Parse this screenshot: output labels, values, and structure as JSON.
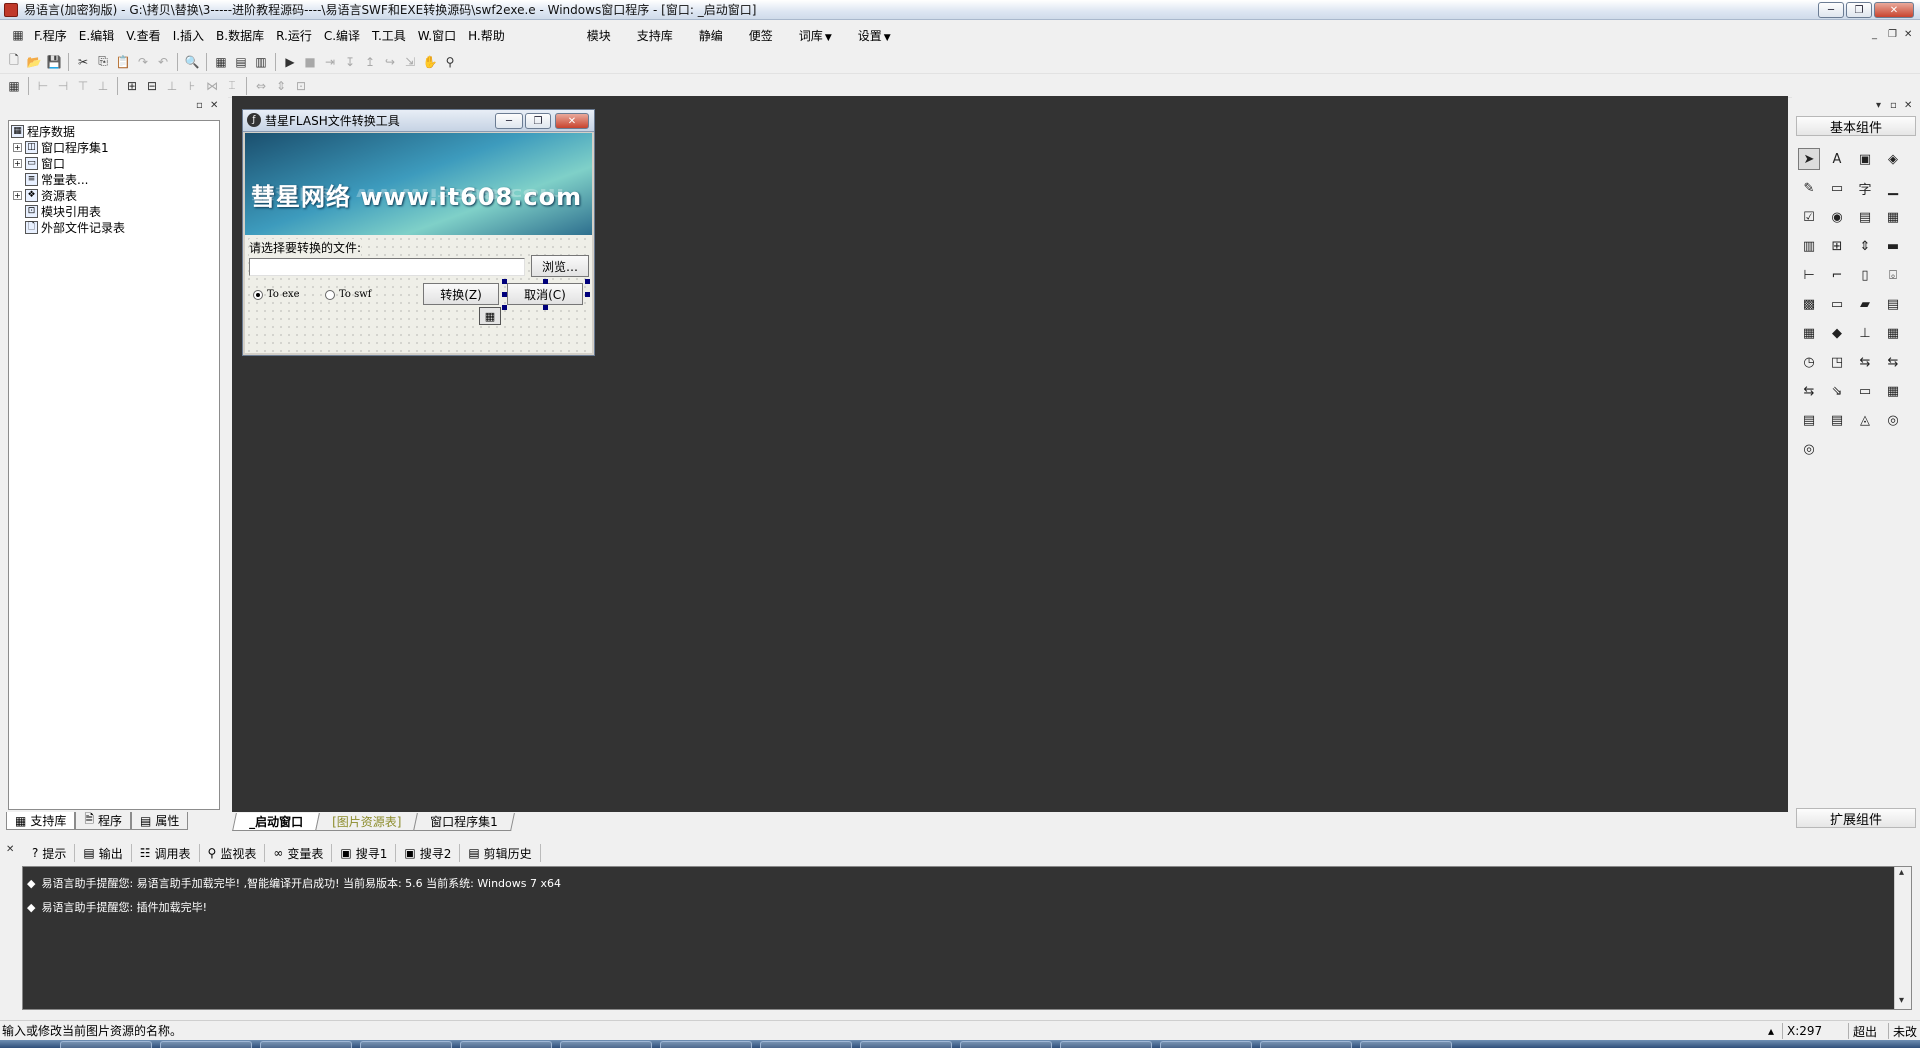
{
  "window": {
    "title": "易语言(加密狗版) - G:\\拷贝\\替换\\3-----进阶教程源码----\\易语言SWF和EXE转换源码\\swf2exe.e - Windows窗口程序 - [窗口: _启动窗口]",
    "minimize_glyph": "─",
    "maximize_glyph": "❐",
    "close_glyph": "✕"
  },
  "menu": {
    "items": [
      "F.程序",
      "E.编辑",
      "V.查看",
      "I.插入",
      "B.数据库",
      "R.运行",
      "C.编译",
      "T.工具",
      "W.窗口",
      "H.帮助"
    ],
    "extra": [
      "模块",
      "支持库",
      "静编",
      "便签",
      "词库",
      "设置"
    ]
  },
  "left_panel": {
    "tree": [
      {
        "label": "程序数据",
        "level": 0,
        "icon": "database-icon"
      },
      {
        "label": "窗口程序集1",
        "level": 1,
        "icon": "module-icon",
        "expander": "+"
      },
      {
        "label": "窗口",
        "level": 1,
        "icon": "window-icon",
        "expander": "+"
      },
      {
        "label": "常量表...",
        "level": 1,
        "icon": "constant-icon"
      },
      {
        "label": "资源表",
        "level": 1,
        "icon": "resource-icon",
        "expander": "+"
      },
      {
        "label": "模块引用表",
        "level": 1,
        "icon": "module-ref-icon"
      },
      {
        "label": "外部文件记录表",
        "level": 1,
        "icon": "file-icon"
      }
    ],
    "tabs": [
      "支持库",
      "程序",
      "属性"
    ]
  },
  "form": {
    "title": "彗星FLASH文件转换工具",
    "banner_text": "彗星网络 www.it608.com",
    "prompt_label": "请选择要转换的文件:",
    "file_input_value": "",
    "browse_button": "浏览…",
    "radio_exe": "To exe",
    "radio_swf": "To swf",
    "radio_selected": "To exe",
    "convert_button": "转换(Z)",
    "cancel_button": "取消(C)"
  },
  "designer_tabs": [
    "_启动窗口",
    "[图片资源表]",
    "窗口程序集1"
  ],
  "components_panel": {
    "header": "基本组件",
    "footer": "扩展组件",
    "icons": [
      "➤",
      "A",
      "▣",
      "◈",
      "✎",
      "▭",
      "字",
      "▁",
      "☑",
      "◉",
      "▤",
      "▦",
      "▥",
      "⊞",
      "⇕",
      "▬",
      "⊢",
      "⌐",
      "▯",
      "⌻",
      "▩",
      "▭",
      "▰",
      "▤",
      "▦",
      "◆",
      "⊥",
      "▦",
      "◷",
      "◳",
      "⇆",
      "⇆",
      "⇆",
      "⇘",
      "▭",
      "▦",
      "▤",
      "▤",
      "◬",
      "◎",
      "◎"
    ]
  },
  "output_tabs": [
    "提示",
    "输出",
    "调用表",
    "监视表",
    "变量表",
    "搜寻1",
    "搜寻2",
    "剪辑历史"
  ],
  "output_lines": [
    "易语言助手提醒您: 易语言助手加载完毕! ,智能编译开启成功! 当前易版本: 5.6 当前系统: Windows 7 x64",
    "易语言助手提醒您: 插件加载完毕!"
  ],
  "status": {
    "message": "输入或修改当前图片资源的名称。",
    "x_coord": "X:297",
    "mode": "超出",
    "state": "未改"
  }
}
